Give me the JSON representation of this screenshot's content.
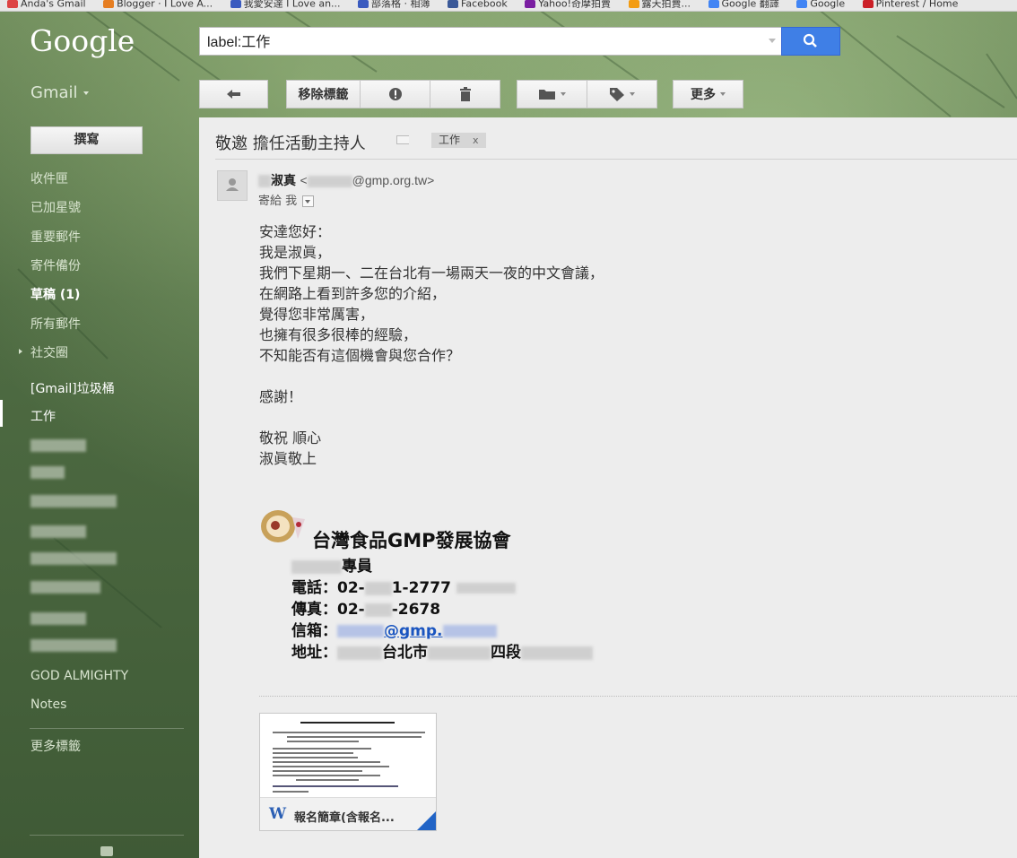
{
  "bookmarks": [
    "Anda's Gmail",
    "Blogger · I Love A...",
    "我愛安達 I Love an...",
    "部落格 · 相簿",
    "Facebook",
    "Yahoo!奇摩拍賣",
    "露天拍賣...",
    "Google 翻譯",
    "Google",
    "Pinterest / Home"
  ],
  "header": {
    "logo": "Google",
    "search_value": "label:工作",
    "gmail_label": "Gmail"
  },
  "toolbar": {
    "remove_label": "移除標籤",
    "more_label": "更多"
  },
  "sidebar": {
    "compose_label": "撰寫",
    "items": [
      {
        "label": "收件匣"
      },
      {
        "label": "已加星號"
      },
      {
        "label": "重要郵件"
      },
      {
        "label": "寄件備份"
      },
      {
        "label": "草稿 (1)"
      },
      {
        "label": "所有郵件"
      },
      {
        "label": "社交圈"
      },
      {
        "label": "[Gmail]垃圾桶"
      },
      {
        "label": "工作"
      },
      {
        "label": "GOD ALMIGHTY"
      },
      {
        "label": "Notes"
      },
      {
        "label": "更多標籤"
      }
    ]
  },
  "email": {
    "subject": "敬邀 擔任活動主持人",
    "label_tag": "工作",
    "label_close": "x",
    "sender_name": "淑真",
    "sender_open": "<",
    "sender_domain": "@gmp.org.tw>",
    "to_line": "寄給 我",
    "body": [
      "安達您好：",
      "我是淑眞，",
      "我們下星期一、二在台北有一場兩天一夜的中文會議，",
      "在網路上看到許多您的介紹，",
      "覺得您非常厲害，",
      "也擁有很多很棒的經驗，",
      "不知能否有這個機會與您合作？",
      "",
      "感謝！",
      "",
      "敬祝 順心",
      "淑眞敬上"
    ],
    "signature": {
      "org": "台灣食品GMP發展協會",
      "title": "專員",
      "phone_label": "電話：02-",
      "phone_tail": "1-2777",
      "fax_label": "傳真：02-",
      "fax_tail": "-2678",
      "mail_label": "信箱：",
      "mail_link": "@gmp.",
      "addr_label": "地址：",
      "addr_city": "台北市",
      "addr_section": "四段"
    },
    "attachment": {
      "name": "報名簡章(含報名...",
      "icon": "W"
    }
  }
}
